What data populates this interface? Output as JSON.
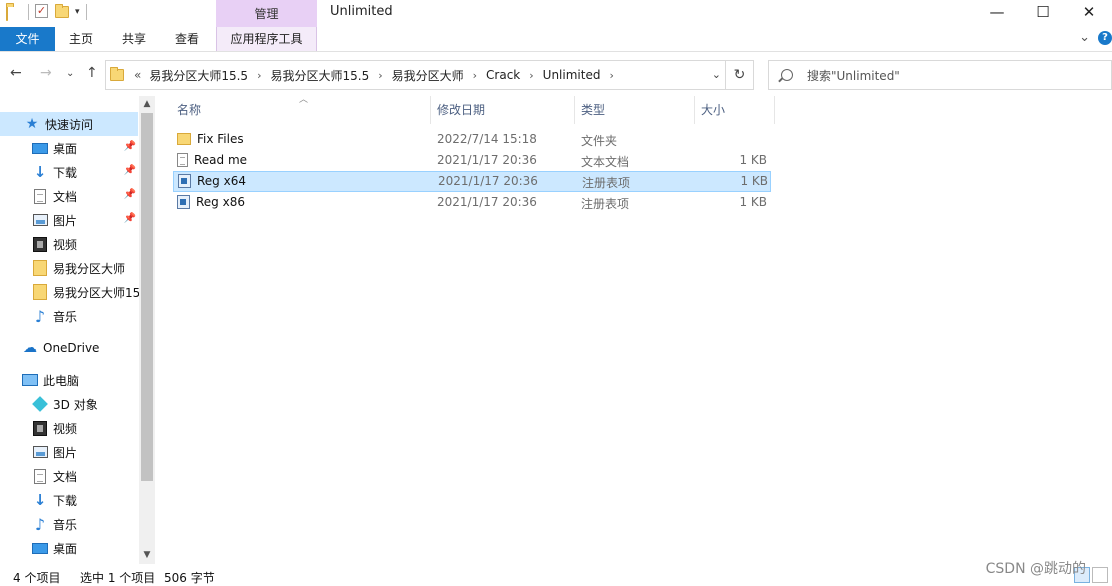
{
  "window": {
    "title": "Unlimited",
    "context_tab_header": "管理",
    "controls": {
      "minimize": "—",
      "maximize": "☐",
      "close": "✕"
    }
  },
  "ribbon": {
    "tabs": [
      "文件",
      "主页",
      "共享",
      "查看",
      "应用程序工具"
    ],
    "expand_icon": "chevron-down-icon",
    "help_label": "?"
  },
  "address": {
    "overflow": "«",
    "crumbs": [
      "易我分区大师15.5",
      "易我分区大师15.5",
      "易我分区大师",
      "Crack",
      "Unlimited"
    ],
    "search_placeholder": "搜索\"Unlimited\""
  },
  "nav": {
    "quick_access": "快速访问",
    "items": [
      {
        "label": "桌面",
        "icon": "desktop-icon",
        "pinned": true
      },
      {
        "label": "下载",
        "icon": "download-icon",
        "pinned": true
      },
      {
        "label": "文档",
        "icon": "document-icon",
        "pinned": true
      },
      {
        "label": "图片",
        "icon": "picture-icon",
        "pinned": true
      },
      {
        "label": "视频",
        "icon": "video-icon",
        "pinned": false
      },
      {
        "label": "易我分区大师",
        "icon": "folder-icon",
        "pinned": false
      },
      {
        "label": "易我分区大师15",
        "icon": "folder-icon",
        "pinned": false
      },
      {
        "label": "音乐",
        "icon": "music-icon",
        "pinned": false
      }
    ],
    "onedrive": "OneDrive",
    "this_pc": "此电脑",
    "pc_items": [
      {
        "label": "3D 对象",
        "icon": "3d-objects-icon"
      },
      {
        "label": "视频",
        "icon": "video-icon"
      },
      {
        "label": "图片",
        "icon": "picture-icon"
      },
      {
        "label": "文档",
        "icon": "document-icon"
      },
      {
        "label": "下载",
        "icon": "download-icon"
      },
      {
        "label": "音乐",
        "icon": "music-icon"
      },
      {
        "label": "桌面",
        "icon": "desktop-icon"
      }
    ]
  },
  "columns": {
    "name": "名称",
    "date": "修改日期",
    "type": "类型",
    "size": "大小"
  },
  "files": [
    {
      "name": "Fix Files",
      "date": "2022/7/14 15:18",
      "type": "文件夹",
      "size": "",
      "icon": "folder-icon",
      "selected": false
    },
    {
      "name": "Read me",
      "date": "2021/1/17 20:36",
      "type": "文本文档",
      "size": "1 KB",
      "icon": "text-file-icon",
      "selected": false
    },
    {
      "name": "Reg x64",
      "date": "2021/1/17 20:36",
      "type": "注册表项",
      "size": "1 KB",
      "icon": "registry-file-icon",
      "selected": true
    },
    {
      "name": "Reg x86",
      "date": "2021/1/17 20:36",
      "type": "注册表项",
      "size": "1 KB",
      "icon": "registry-file-icon",
      "selected": false
    }
  ],
  "status": {
    "count": "4 个项目",
    "selected": "选中 1 个项目",
    "size": "506 字节"
  },
  "watermark": "CSDN @跳动的"
}
